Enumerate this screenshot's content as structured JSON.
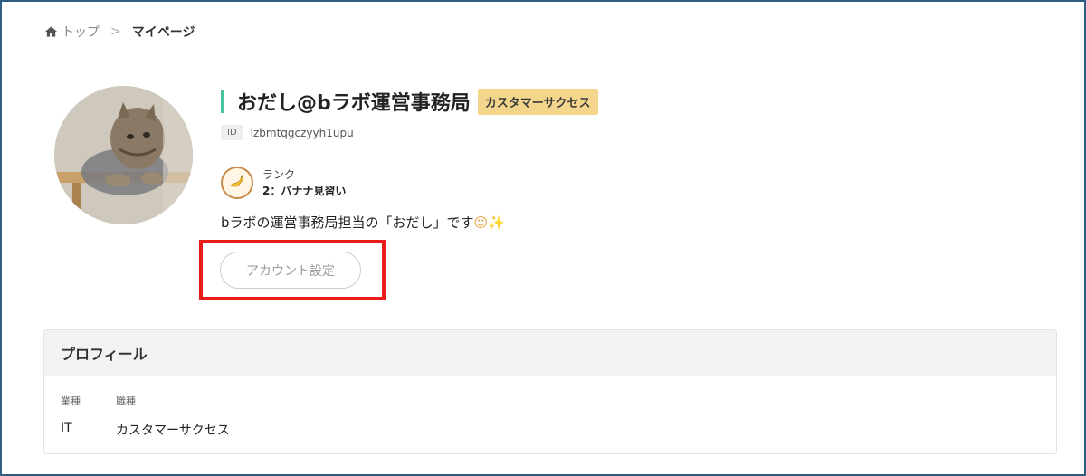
{
  "breadcrumb": {
    "home": "トップ",
    "separator": ">",
    "current": "マイページ"
  },
  "user": {
    "name": "おだし@bラボ運営事務局",
    "role_badge": "カスタマーサクセス",
    "id_label": "ID",
    "id_value": "lzbmtqgczyyh1upu",
    "rank_label": "ランク",
    "rank_value": "2：バナナ見習い",
    "bio": "bラボの運営事務局担当の「おだし」です",
    "bio_emoji": "☺✨"
  },
  "actions": {
    "account_settings": "アカウント設定"
  },
  "profile": {
    "title": "プロフィール",
    "columns": [
      "業種",
      "職種"
    ],
    "values": [
      "IT",
      "カスタマーサクセス"
    ]
  },
  "colors": {
    "accent_bar": "#4bc4a2",
    "badge": "#f3d58c",
    "highlight": "#ea1b1b",
    "frame": "#2f5e82"
  },
  "icons": {
    "home": "home-icon",
    "rank": "banana-icon"
  }
}
